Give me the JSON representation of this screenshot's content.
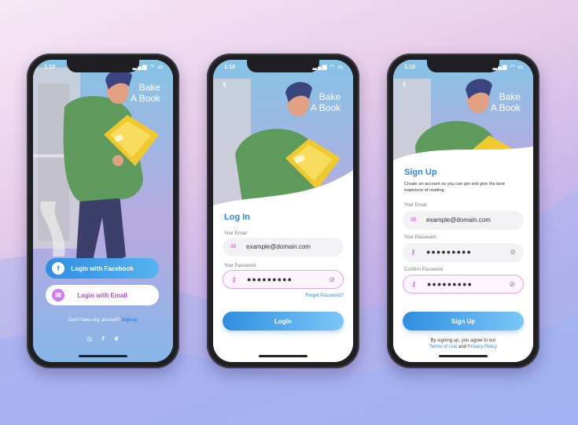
{
  "colors": {
    "accent": "#2e86e0",
    "facebook": "#2f8ee0",
    "email_pink": "#cf7cf0",
    "shirt": "#5d9a5c",
    "book": "#f0c92e"
  },
  "status": {
    "time": "1:10"
  },
  "brand": {
    "line1": "Bake",
    "line2": "A Book"
  },
  "welcome": {
    "facebook_label": "Login with Facebook",
    "email_label": "Login with Email",
    "no_account": "Don't have any account?",
    "signup_link": "Signup",
    "social_icons": [
      "instagram-icon",
      "facebook-icon",
      "twitter-icon"
    ]
  },
  "login": {
    "title": "Log In",
    "email_label": "Your Email",
    "email_value": "example@domain.com",
    "password_label": "Your Password",
    "password_value": "●●●●●●●●●",
    "forgot": "Forget Password?",
    "button": "Login"
  },
  "signup": {
    "title": "Sign Up",
    "subtitle": "Create an account so you can get and give the best experince of reading",
    "email_label": "Your Email",
    "email_value": "example@domain.com",
    "password_label": "Your Password",
    "password_value": "●●●●●●●●●",
    "confirm_label": "Confirm Password",
    "confirm_value": "●●●●●●●●●",
    "button": "Sign Up",
    "terms_prefix": "By signing up, you agree to our",
    "terms_link": "Terms of Use",
    "terms_and": "and",
    "privacy_link": "Privacy Policy"
  }
}
